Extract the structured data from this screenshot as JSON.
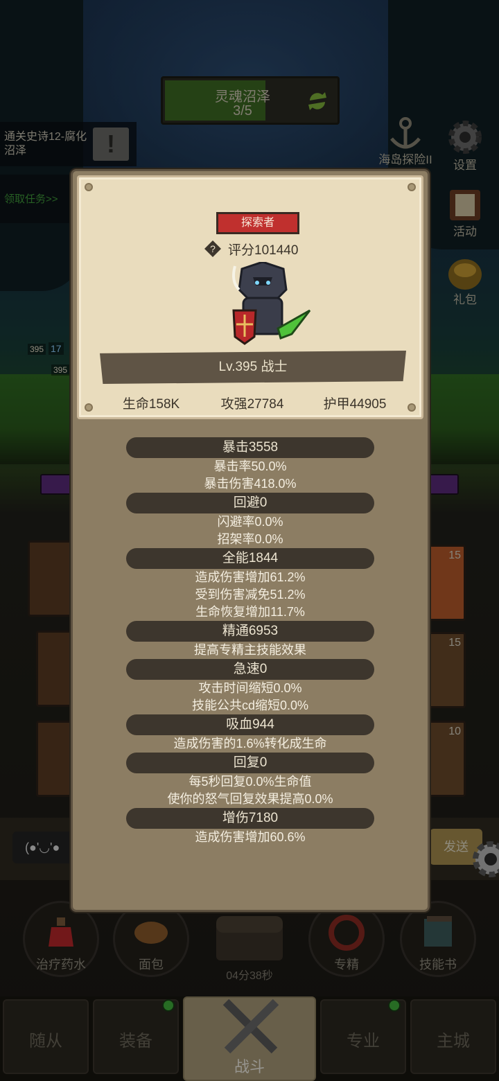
{
  "stage": {
    "name": "灵魂沼泽",
    "progress_text": "3/5",
    "progress": 0.6
  },
  "quest": {
    "text": "通关史诗12-腐化沼泽",
    "mark": "!",
    "claim_label": "领取任务>>"
  },
  "side_menu": [
    {
      "label": "海岛探险II",
      "icon": "anchor-icon"
    },
    {
      "label": "设置",
      "icon": "gear-icon"
    },
    {
      "label": "活动",
      "icon": "scroll-icon"
    },
    {
      "label": "礼包",
      "icon": "gift-pot-icon"
    }
  ],
  "field": {
    "levels": [
      "395",
      "395"
    ],
    "hp_text": "17"
  },
  "skill_levels": [
    "15",
    "15",
    "10"
  ],
  "chat": {
    "emote": "(●'◡'●",
    "send_label": "发送"
  },
  "dock": [
    {
      "label": "治疗药水",
      "icon": "potion-icon"
    },
    {
      "label": "面包",
      "icon": "bread-icon"
    },
    {
      "label": "",
      "icon": "chest-icon"
    },
    {
      "label": "专精",
      "icon": "specialization-icon"
    },
    {
      "label": "技能书",
      "icon": "skill-book-icon"
    }
  ],
  "timer": "04分38秒",
  "tabs": [
    {
      "label": "随从",
      "badge": false
    },
    {
      "label": "装备",
      "badge": true
    },
    {
      "label": "战斗",
      "badge": false,
      "active": true
    },
    {
      "label": "专业",
      "badge": true
    },
    {
      "label": "主城",
      "badge": false
    }
  ],
  "panel": {
    "title_badge": "探索者",
    "score": "评分101440",
    "level_class": "Lv.395 战士",
    "base_stats": {
      "hp": "生命158K",
      "attack": "攻强27784",
      "armor": "护甲44905"
    },
    "stats": [
      {
        "header": "暴击3558",
        "lines": [
          "暴击率50.0%",
          "暴击伤害418.0%"
        ]
      },
      {
        "header": "回避0",
        "lines": [
          "闪避率0.0%",
          "招架率0.0%"
        ]
      },
      {
        "header": "全能1844",
        "lines": [
          "造成伤害增加61.2%",
          "受到伤害减免51.2%",
          "生命恢复增加11.7%"
        ]
      },
      {
        "header": "精通6953",
        "lines": [
          "提高专精主技能效果"
        ]
      },
      {
        "header": "急速0",
        "lines": [
          "攻击时间缩短0.0%",
          "技能公共cd缩短0.0%"
        ]
      },
      {
        "header": "吸血944",
        "lines": [
          "造成伤害的1.6%转化成生命"
        ]
      },
      {
        "header": "回复0",
        "lines": [
          "每5秒回复0.0%生命值",
          "使你的怒气回复效果提高0.0%"
        ]
      },
      {
        "header": "增伤7180",
        "lines": [
          "造成伤害增加60.6%"
        ]
      }
    ]
  },
  "colors": {
    "badge_red": "#c0302e",
    "panel": "#8c7d63",
    "parchment": "#e9dcbd",
    "stat_bar": "#3d362d",
    "notify_green": "#3fae3a"
  }
}
